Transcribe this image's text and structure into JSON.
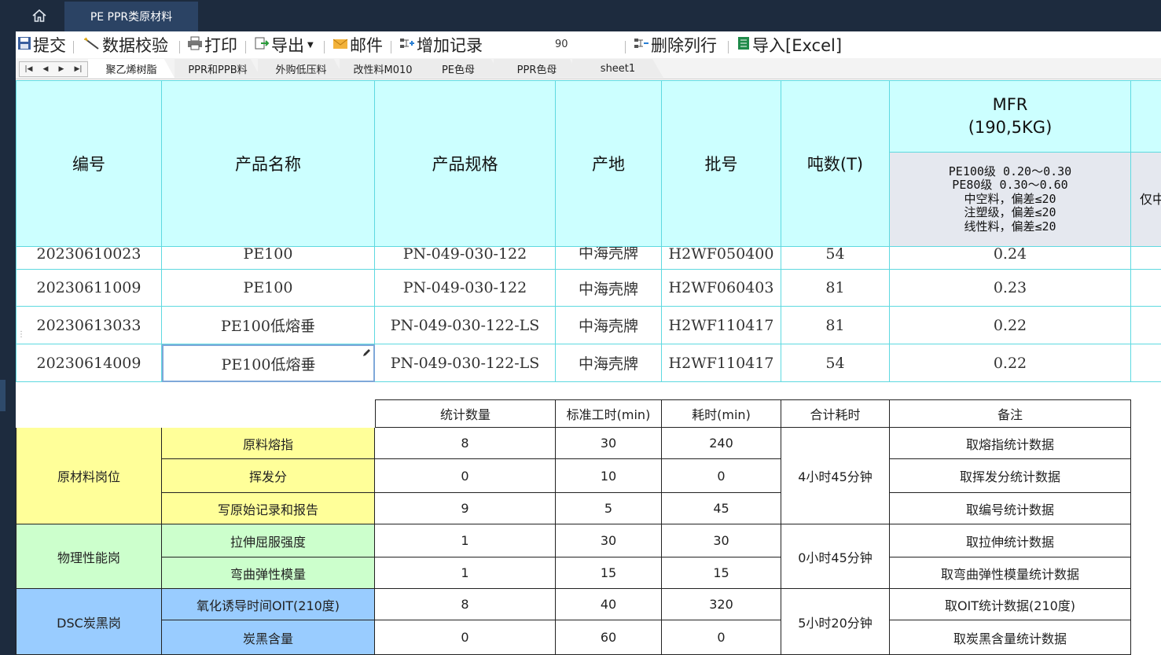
{
  "window": {
    "tab_title": "PE PPR类原材料"
  },
  "toolbar": {
    "submit": "提交",
    "validate": "数据校验",
    "print": "打印",
    "export": "导出",
    "mail": "邮件",
    "add_record": "增加记录",
    "number_value": "90",
    "delete_column": "删除列行",
    "import_excel": "导入[Excel]"
  },
  "sheets": [
    "聚乙烯树脂",
    "PPR和PPB料",
    "外购低压料",
    "改性料M010",
    "PE色母",
    "PPR色母",
    "sheet1"
  ],
  "main_table": {
    "headers": [
      "编号",
      "产品名称",
      "产品规格",
      "产地",
      "批号",
      "吨数(T)"
    ],
    "mfr_header": "MFR\n(190,5KG)",
    "mfr_spec": "PE100级 0.20～0.30\nPE80级 0.30～0.60\n中空料，偏差≤20\n注塑级，偏差≤20\n线性料，偏差≤20",
    "cut_header": "仅中",
    "rows": [
      [
        "20230610023",
        "PE100",
        "PN-049-030-122",
        "中海壳牌",
        "H2WF050400",
        "54",
        "0.24"
      ],
      [
        "20230611009",
        "PE100",
        "PN-049-030-122",
        "中海壳牌",
        "H2WF060403",
        "81",
        "0.23"
      ],
      [
        "20230613033",
        "PE100低熔垂",
        "PN-049-030-122-LS",
        "中海壳牌",
        "H2WF110417",
        "81",
        "0.22"
      ],
      [
        "20230614009",
        "PE100低熔垂",
        "PN-049-030-122-LS",
        "中海壳牌",
        "H2WF110417",
        "54",
        "0.22"
      ]
    ]
  },
  "stats": {
    "headers": [
      "统计数量",
      "标准工时(min)",
      "耗时(min)",
      "合计耗时",
      "备注"
    ],
    "groups": [
      {
        "name": "原材料岗位",
        "total": "4小时45分钟",
        "color": "#ffff99",
        "items": [
          {
            "label": "原料熔指",
            "count": "8",
            "std": "30",
            "time": "240",
            "note": "取熔指统计数据"
          },
          {
            "label": "挥发分",
            "count": "0",
            "std": "10",
            "time": "0",
            "note": "取挥发分统计数据"
          },
          {
            "label": "写原始记录和报告",
            "count": "9",
            "std": "5",
            "time": "45",
            "note": "取编号统计数据"
          }
        ]
      },
      {
        "name": "物理性能岗",
        "total": "0小时45分钟",
        "color": "#ccffcc",
        "items": [
          {
            "label": "拉伸屈服强度",
            "count": "1",
            "std": "30",
            "time": "30",
            "note": "取拉伸统计数据"
          },
          {
            "label": "弯曲弹性模量",
            "count": "1",
            "std": "15",
            "time": "15",
            "note": "取弯曲弹性模量统计数据"
          }
        ]
      },
      {
        "name": "DSC炭黑岗",
        "total": "5小时20分钟",
        "color": "#99ccff",
        "items": [
          {
            "label": "氧化诱导时间OIT(210度)",
            "count": "8",
            "std": "40",
            "time": "320",
            "note": "取OIT统计数据(210度)"
          },
          {
            "label": "炭黑含量",
            "count": "0",
            "std": "60",
            "time": "0",
            "note": "取炭黑含量统计数据"
          }
        ]
      }
    ]
  }
}
